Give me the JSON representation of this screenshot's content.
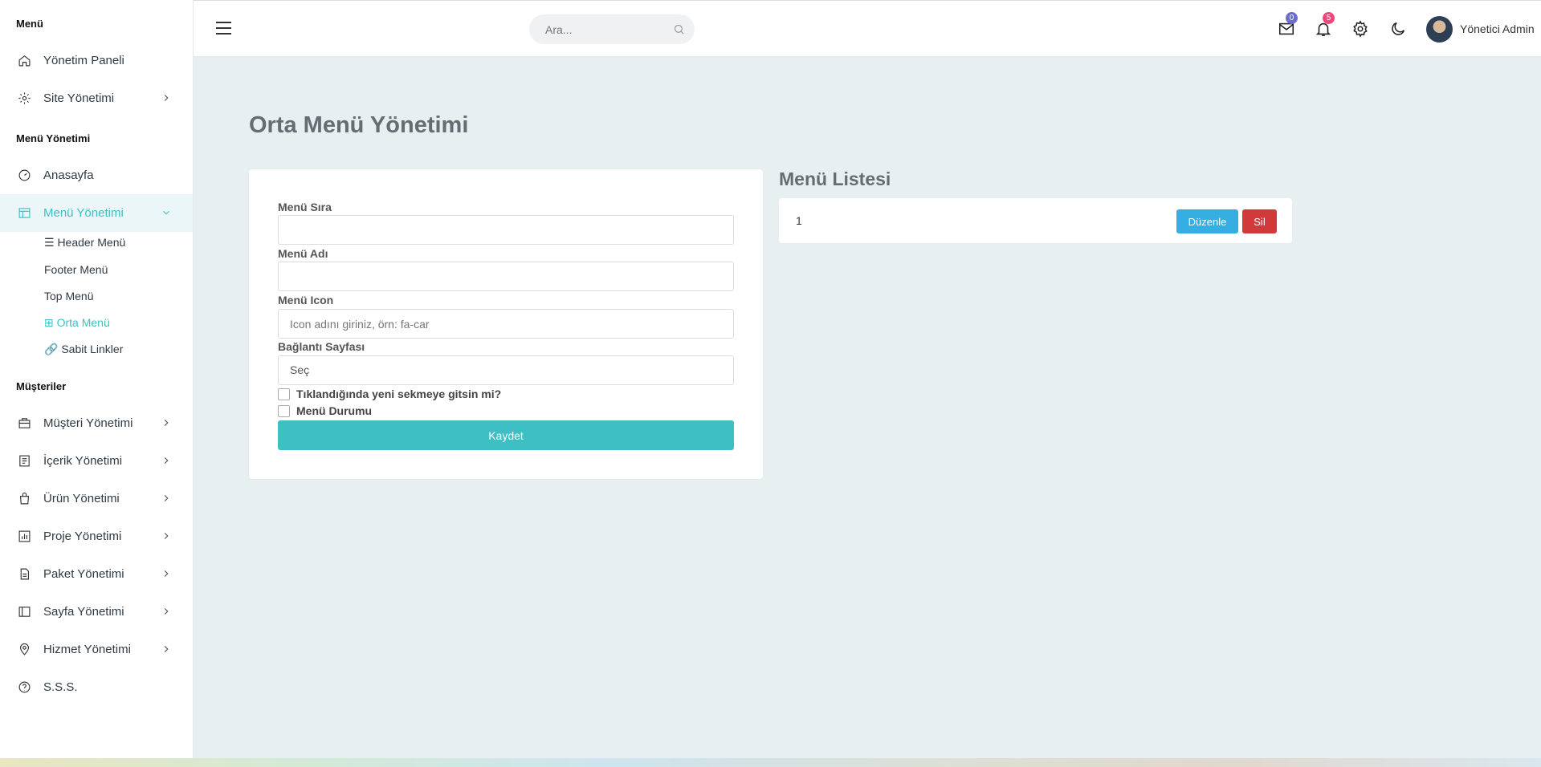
{
  "sidebar": {
    "section_menu": "Menü",
    "section_menu_mgmt": "Menü Yönetimi",
    "section_customers": "Müşteriler",
    "items": {
      "dashboard": "Yönetim Paneli",
      "site": "Site Yönetimi",
      "home": "Anasayfa",
      "menu": "Menü Yönetimi",
      "customers": "Müşteri Yönetimi",
      "content": "İçerik Yönetimi",
      "products": "Ürün Yönetimi",
      "projects": "Proje Yönetimi",
      "packages": "Paket Yönetimi",
      "pages": "Sayfa Yönetimi",
      "services": "Hizmet Yönetimi",
      "faq": "S.S.S."
    },
    "submenu": {
      "header": "☰ Header Menü",
      "footer": "Footer Menü",
      "top": "Top Menü",
      "middle": "⊞ Orta Menü",
      "fixed": "🔗 Sabit Linkler"
    }
  },
  "topbar": {
    "search_placeholder": "Ara...",
    "mail_count": "0",
    "notif_count": "5",
    "user_name": "Yönetici Admin",
    "mail_badge_color": "#6c6fc9",
    "notif_badge_color": "#f0467c"
  },
  "page": {
    "title": "Orta Menü Yönetimi"
  },
  "form": {
    "order_label": "Menü Sıra",
    "order_value": "",
    "name_label": "Menü Adı",
    "name_value": "",
    "icon_label": "Menü Icon",
    "icon_placeholder": "Icon adını giriniz, örn: fa-car",
    "link_label": "Bağlantı Sayfası",
    "link_selected": "Seç",
    "newtab_label": "Tıklandığında yeni sekmeye gitsin mi?",
    "status_label": "Menü Durumu",
    "save_label": "Kaydet"
  },
  "list": {
    "title": "Menü Listesi",
    "rows": [
      {
        "order": "1",
        "edit_label": "Düzenle",
        "delete_label": "Sil"
      }
    ]
  },
  "colors": {
    "accent": "#3dbfc4",
    "edit": "#35aee1",
    "delete": "#d13a3a"
  }
}
